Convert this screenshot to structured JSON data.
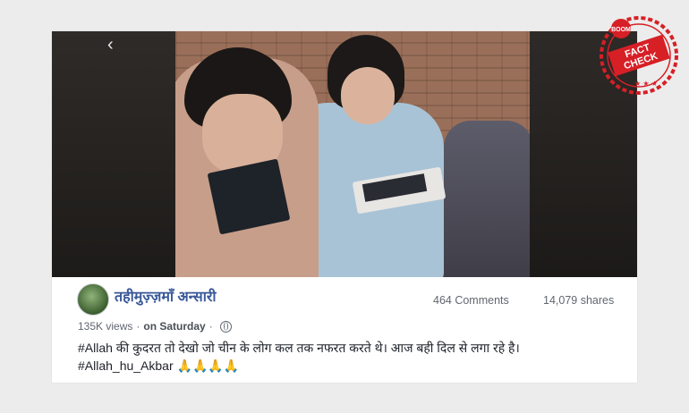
{
  "stamp": {
    "top_text": "BOOM",
    "line1": "FACT",
    "line2": "CHECK",
    "color": "#d71f26"
  },
  "post": {
    "author": "तहीमुज़्ज़माँ अन्सारी",
    "comments": "464 Comments",
    "shares": "14,079 shares",
    "views": "135K views",
    "separator": "·",
    "date": "on Saturday",
    "separator2": "·",
    "caption_line1": "#Allah की कुदरत तो देखो जो चीन के लोग कल तक नफरत करते थे। आज बही दिल से लगा रहे है।",
    "caption_line2": "#Allah_hu_Akbar 🙏🙏🙏🙏",
    "link_color": "#385898"
  },
  "video": {
    "back_icon": "chevron-left-icon",
    "back_glyph": "‹"
  }
}
